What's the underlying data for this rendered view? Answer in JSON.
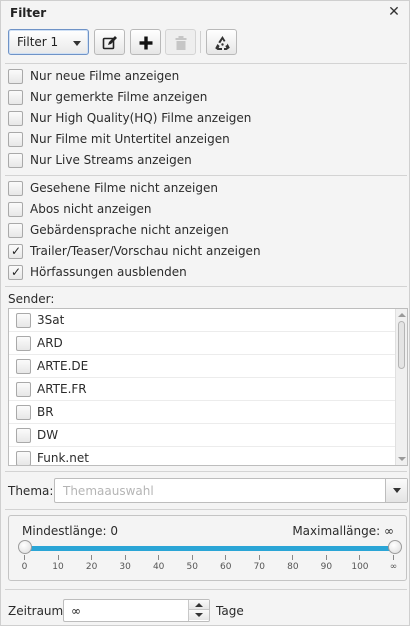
{
  "window": {
    "title": "Filter",
    "close_glyph": "✕"
  },
  "toolbar": {
    "filter_select_value": "Filter 1",
    "icons": [
      "edit-icon",
      "plus-icon",
      "trash-icon",
      "recycle-icon"
    ]
  },
  "checks_group1": [
    {
      "label": "Nur neue Filme anzeigen",
      "checked": false
    },
    {
      "label": "Nur gemerkte Filme anzeigen",
      "checked": false
    },
    {
      "label": "Nur High Quality(HQ) Filme anzeigen",
      "checked": false
    },
    {
      "label": "Nur Filme mit Untertitel anzeigen",
      "checked": false
    },
    {
      "label": "Nur Live Streams anzeigen",
      "checked": false
    }
  ],
  "checks_group2": [
    {
      "label": "Gesehene Filme nicht anzeigen",
      "checked": false
    },
    {
      "label": "Abos nicht anzeigen",
      "checked": false
    },
    {
      "label": "Gebärdensprache nicht anzeigen",
      "checked": false
    },
    {
      "label": "Trailer/Teaser/Vorschau nicht anzeigen",
      "checked": true
    },
    {
      "label": "Hörfassungen ausblenden",
      "checked": true
    }
  ],
  "sender": {
    "label": "Sender:",
    "items": [
      {
        "label": "3Sat",
        "checked": false
      },
      {
        "label": "ARD",
        "checked": false
      },
      {
        "label": "ARTE.DE",
        "checked": false
      },
      {
        "label": "ARTE.FR",
        "checked": false
      },
      {
        "label": "BR",
        "checked": false
      },
      {
        "label": "DW",
        "checked": false
      },
      {
        "label": "Funk.net",
        "checked": false
      }
    ]
  },
  "thema": {
    "label": "Thema:",
    "placeholder": "Themaauswahl"
  },
  "laenge": {
    "min_label": "Mindestlänge: 0",
    "max_label": "Maximallänge: ∞",
    "min_value": 0,
    "max_value": "∞",
    "ticks": [
      "0",
      "10",
      "20",
      "30",
      "40",
      "50",
      "60",
      "70",
      "80",
      "90",
      "100",
      "∞"
    ],
    "accent": "#2aa5d6"
  },
  "zeitraum": {
    "label": "Zeitraum:",
    "value": "∞",
    "unit": "Tage"
  }
}
